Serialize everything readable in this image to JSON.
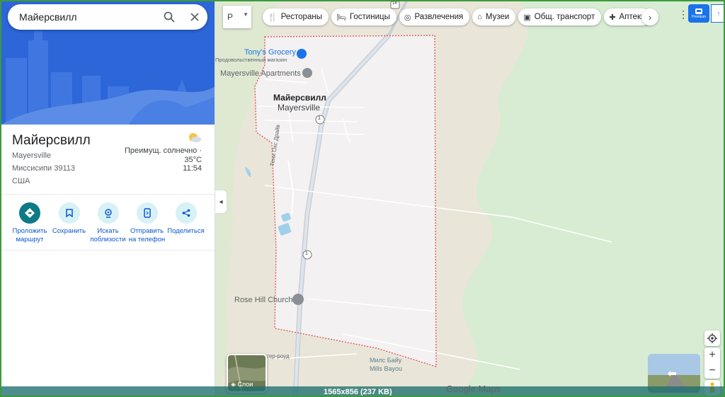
{
  "search": {
    "query": "Майерсвилл"
  },
  "place": {
    "title": "Майерсвилл",
    "address_lines": [
      "Mayersville",
      "Миссисипи 39113",
      "США"
    ]
  },
  "weather": {
    "condition": "Преимущ. солнечно ·",
    "temperature": "35°C",
    "time": "11:54"
  },
  "actions": [
    {
      "label": "Проложить\nмаршрут",
      "icon": "directions-icon"
    },
    {
      "label": "Сохранить",
      "icon": "bookmark-icon"
    },
    {
      "label": "Искать\nпоблизости",
      "icon": "nearby-icon"
    },
    {
      "label": "Отправить\nна телефон",
      "icon": "send-to-phone-icon"
    },
    {
      "label": "Поделиться",
      "icon": "share-icon"
    }
  ],
  "map_controls": {
    "map_type_label": "Р",
    "layers_label": "Слои",
    "premium_label": "Premium"
  },
  "chips": [
    {
      "label": "Рестораны",
      "icon": "restaurant-icon",
      "glyph": "🍴"
    },
    {
      "label": "Гостиницы",
      "icon": "hotel-icon",
      "glyph": "🛏"
    },
    {
      "label": "Развлечения",
      "icon": "camera-icon",
      "glyph": "◎"
    },
    {
      "label": "Музеи",
      "icon": "museum-icon",
      "glyph": "⌂"
    },
    {
      "label": "Общ. транспорт",
      "icon": "transit-icon",
      "glyph": "▣"
    },
    {
      "label": "Аптеки",
      "icon": "pharmacy-icon",
      "glyph": "✚"
    }
  ],
  "map_labels": {
    "grocery_name": "Tony's Grocery",
    "grocery_type": "Продовольственный магазин",
    "apartments": "Mayersville Apartments",
    "city_ru": "Майерсвилл",
    "city_en": "Mayersville",
    "road_vertical": "Тени Окс Драйв",
    "church": "Rose Hill Church",
    "bayou_ru": "Милс Байу",
    "bayou_en": "Mills Bayou",
    "road_bottom": "ртер-роуд",
    "route_1": "1",
    "route_14": "14"
  },
  "brand": "Google Maps",
  "status_bar": "1565x856 (237 KB)",
  "colors": {
    "accent": "#0b57d0",
    "primary_action": "#0e7a86",
    "boundary": "#e05050",
    "hero": "#2d66d9"
  }
}
